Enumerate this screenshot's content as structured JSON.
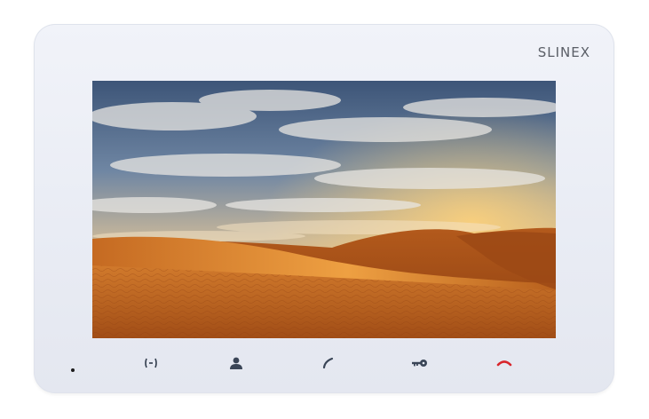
{
  "device": {
    "brand": "SLINEX",
    "buttons": [
      {
        "name": "monitor-button",
        "icon": "monitor-icon",
        "color": "#2f3a4a"
      },
      {
        "name": "user-button",
        "icon": "user-icon",
        "color": "#3a4557"
      },
      {
        "name": "call-button",
        "icon": "handset-icon",
        "color": "#3a4557"
      },
      {
        "name": "unlock-button",
        "icon": "key-icon",
        "color": "#3a4557"
      },
      {
        "name": "hangup-button",
        "icon": "hangup-icon",
        "color": "#d8262c"
      }
    ]
  }
}
